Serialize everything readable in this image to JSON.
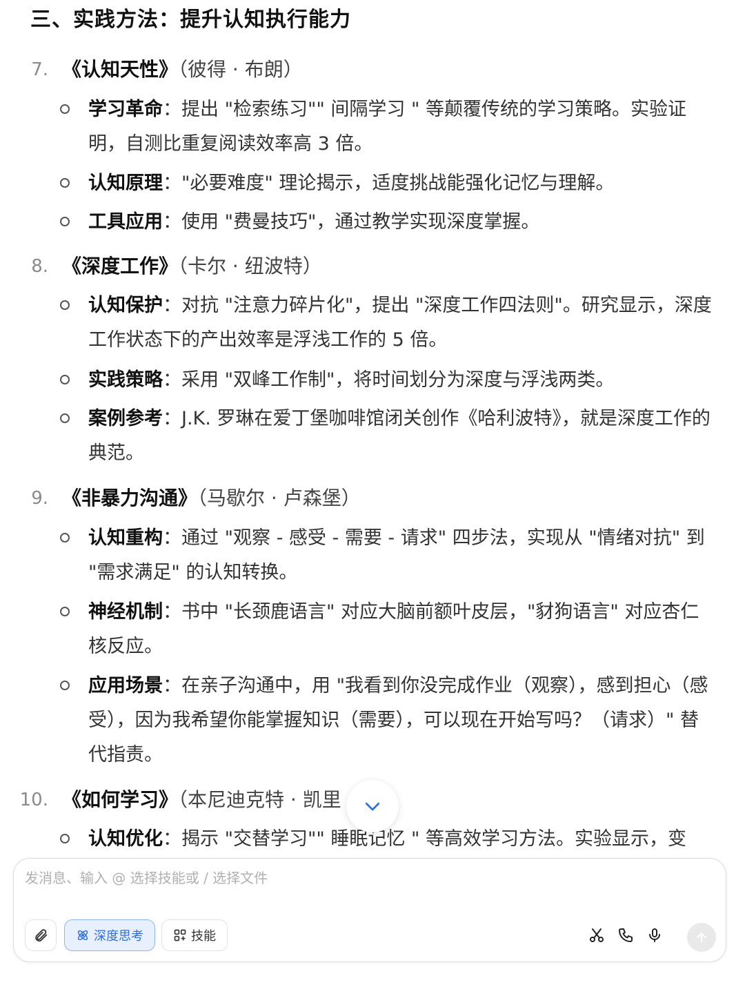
{
  "section": {
    "title": "三、实践方法：提升认知执行能力"
  },
  "books": [
    {
      "number": "7.",
      "name": "《认知天性》",
      "author": "（彼得 · 布朗）",
      "bullets": [
        {
          "head": "学习革命",
          "text": "：提出 \"检索练习\"\" 间隔学习 \" 等颠覆传统的学习策略。实验证明，自测比重复阅读效率高 3 倍。"
        },
        {
          "head": "认知原理",
          "text": "：\"必要难度\" 理论揭示，适度挑战能强化记忆与理解。"
        },
        {
          "head": "工具应用",
          "text": "：使用 \"费曼技巧\"，通过教学实现深度掌握。"
        }
      ]
    },
    {
      "number": "8.",
      "name": "《深度工作》",
      "author": "（卡尔 · 纽波特）",
      "bullets": [
        {
          "head": "认知保护",
          "text": "：对抗 \"注意力碎片化\"，提出 \"深度工作四法则\"。研究显示，深度工作状态下的产出效率是浮浅工作的 5 倍。"
        },
        {
          "head": "实践策略",
          "text": "：采用 \"双峰工作制\"，将时间划分为深度与浮浅两类。"
        },
        {
          "head": "案例参考",
          "text": "：J.K. 罗琳在爱丁堡咖啡馆闭关创作《哈利波特》，就是深度工作的典范。"
        }
      ]
    },
    {
      "number": "9.",
      "name": "《非暴力沟通》",
      "author": "（马歇尔 · 卢森堡）",
      "bullets": [
        {
          "head": "认知重构",
          "text": "：通过 \"观察 - 感受 - 需要 - 请求\" 四步法，实现从 \"情绪对抗\" 到 \"需求满足\" 的认知转换。"
        },
        {
          "head": "神经机制",
          "text": "：书中 \"长颈鹿语言\" 对应大脑前额叶皮层，\"豺狗语言\" 对应杏仁核反应。"
        },
        {
          "head": "应用场景",
          "text": "：在亲子沟通中，用 \"我看到你没完成作业（观察），感到担心（感受），因为我希望你能掌握知识（需要），可以现在开始写吗？（请求）\" 替代指责。"
        }
      ]
    },
    {
      "number": "10.",
      "name": "《如何学习》",
      "author": "（本尼迪克特 · 凯里",
      "bullets": [
        {
          "head": "认知优化",
          "text": "：揭示 \"交替学习\"\" 睡眠记忆 \" 等高效学习方法。实验显示，变"
        }
      ]
    }
  ],
  "composer": {
    "placeholder": "发消息、输入 @ 选择技能或 / 选择文件",
    "deep_think_label": "深度思考",
    "skills_label": "技能"
  },
  "icons": {
    "attach": "paperclip-icon",
    "deep_think": "atom-icon",
    "skills": "grid-icon",
    "scissors": "scissors-icon",
    "phone": "phone-icon",
    "mic": "microphone-icon",
    "send": "arrow-up-icon",
    "scroll": "chevron-down-icon"
  },
  "colors": {
    "accent": "#2f6fde",
    "accent_bg": "#e8f0fe"
  }
}
